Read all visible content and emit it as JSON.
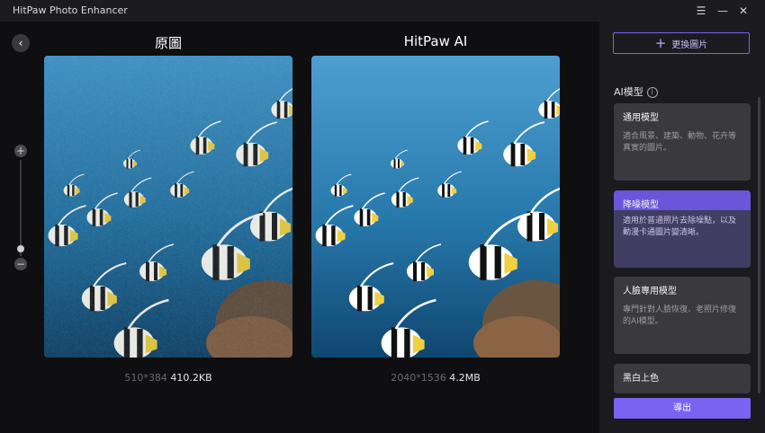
{
  "window": {
    "title": "HitPaw Photo Enhancer",
    "controls": {
      "menu": "☰",
      "minimize": "—",
      "close": "✕"
    }
  },
  "compare": {
    "original": {
      "title": "原圖",
      "dimensions": "510*384",
      "filesize": "410.2KB"
    },
    "enhanced": {
      "title": "HitPaw AI",
      "dimensions": "2040*1536",
      "filesize": "4.2MB"
    }
  },
  "zoom": {
    "plus": "+",
    "minus": "−"
  },
  "panel": {
    "replace_label": "更換圖片",
    "section_title": "AI模型",
    "models": [
      {
        "title": "通用模型",
        "desc": "適合風景、建築、動物、花卉等真實的圖片。"
      },
      {
        "title": "降噪模型",
        "desc": "適用於普通照片去除噪點，以及動漫卡通圖片變清晰。",
        "selected": true
      },
      {
        "title": "人臉專用模型",
        "desc": "專門針對人臉恢復、老照片修復的AI模型。"
      },
      {
        "title": "黑白上色",
        "desc": ""
      }
    ],
    "export_label": "導出"
  },
  "colors": {
    "accent": "#7b63f2",
    "panel_bg": "#1b1b1f",
    "main_bg": "#0f0f12"
  }
}
